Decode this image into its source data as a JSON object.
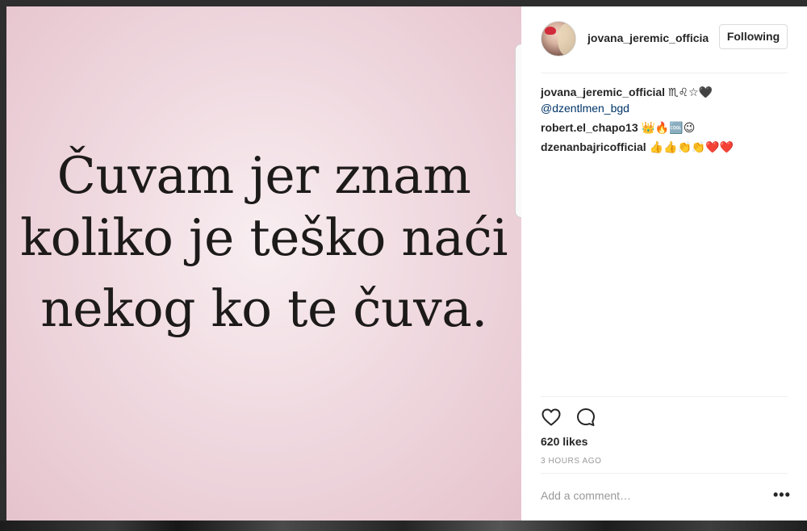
{
  "post": {
    "quote_lines": [
      "Čuvam jer znam",
      "koliko je teško naći",
      "nekog ko te čuva."
    ]
  },
  "header": {
    "username": "jovana_jeremic_official",
    "follow_label": "Following"
  },
  "caption": {
    "username": "jovana_jeremic_official",
    "text": " ♏♌☆🖤",
    "mention": "@dzentlmen_bgd"
  },
  "comments": [
    {
      "username": "robert.el_chapo13",
      "text": " 👑🔥🆒😉"
    },
    {
      "username": "dzenanbajricofficial",
      "text": " 👍👍👏👏❤️❤️"
    }
  ],
  "actions": {
    "like_icon": "heart-icon",
    "comment_icon": "comment-icon",
    "likes": "620 likes",
    "time": "3 HOURS AGO"
  },
  "comment_box": {
    "placeholder": "Add a comment…",
    "more_label": "•••"
  }
}
